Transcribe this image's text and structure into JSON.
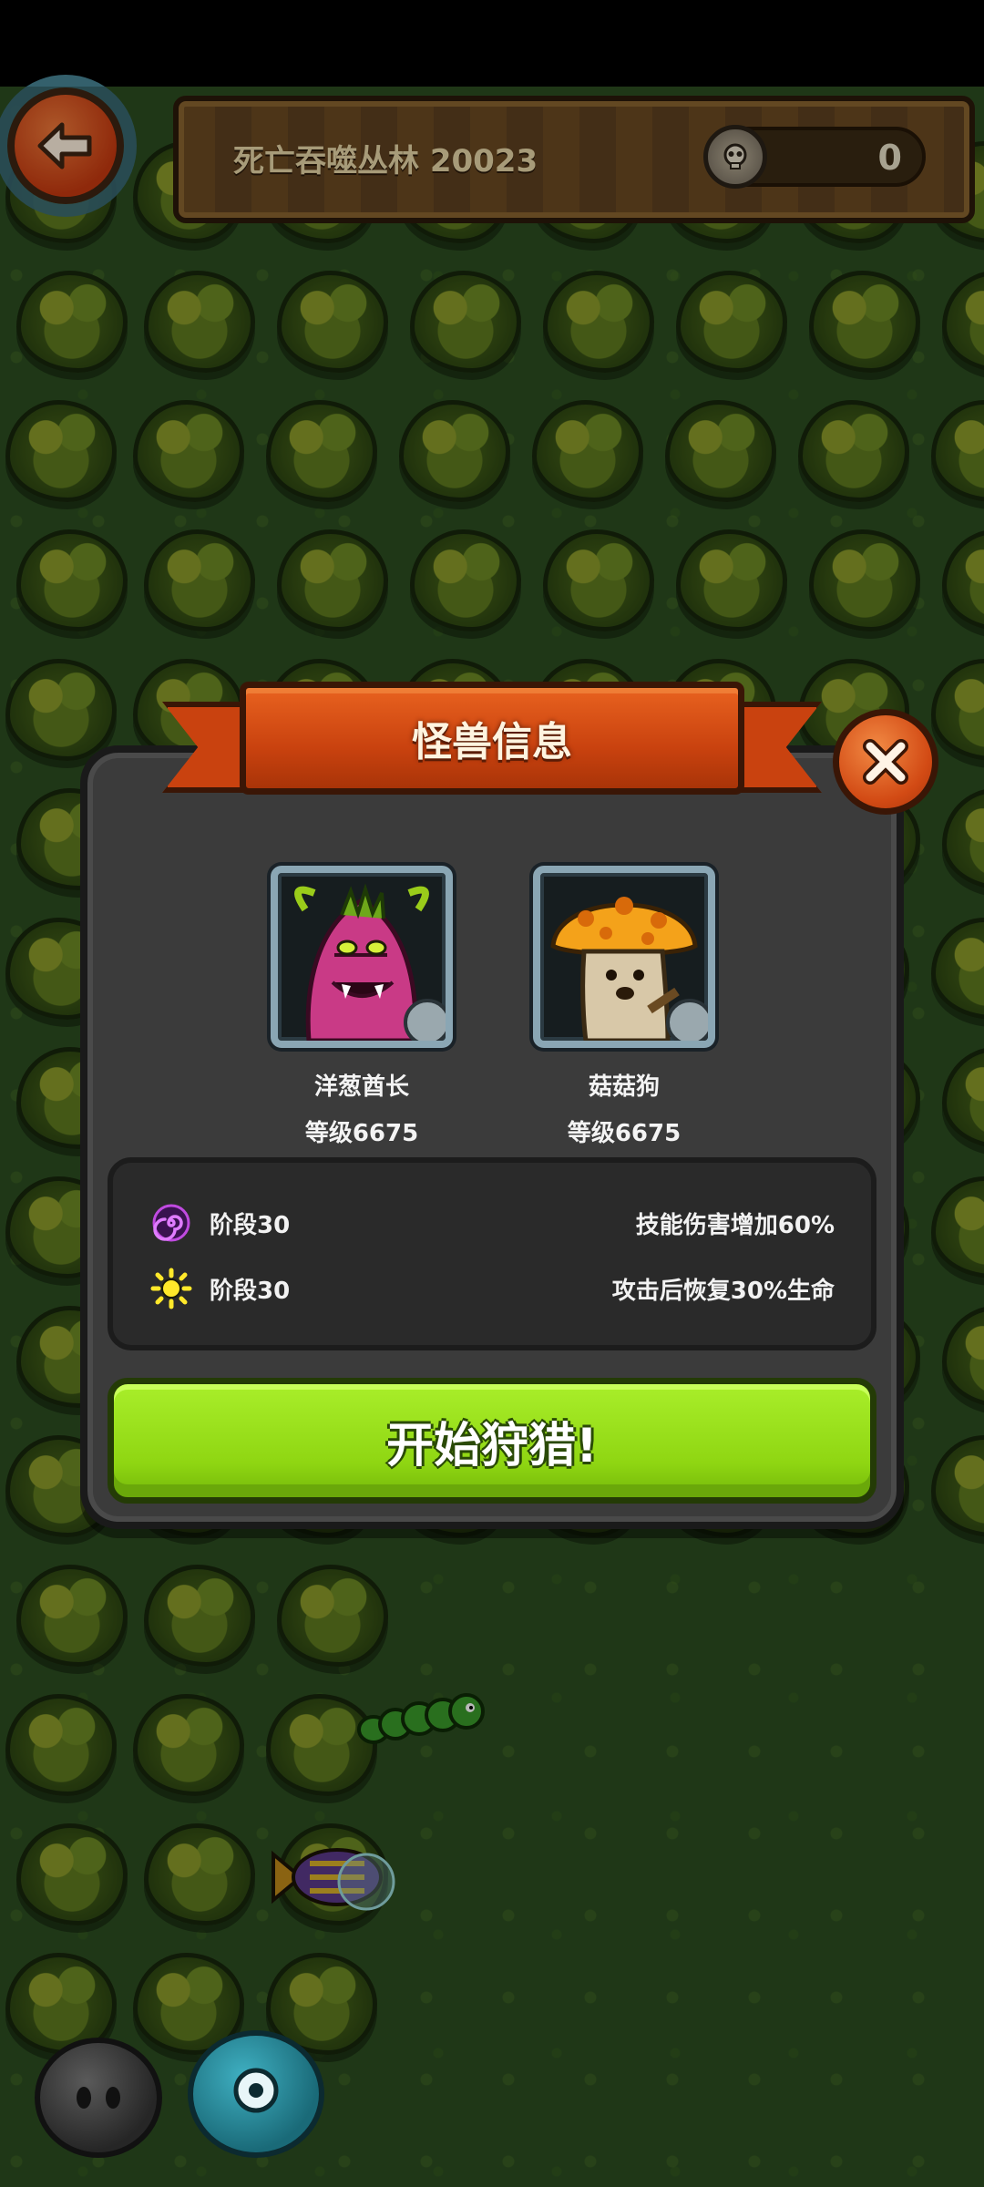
{
  "header": {
    "zone_title": "死亡吞噬丛林 20023",
    "currency_count": "0",
    "back_icon": "arrow-left-icon",
    "coin_icon": "skull-coin-icon"
  },
  "modal": {
    "title": "怪兽信息",
    "close_icon": "close-icon",
    "monsters": [
      {
        "name": "洋葱酋长",
        "level": "等级6675",
        "portrait": "onion-chief-portrait"
      },
      {
        "name": "菇菇狗",
        "level": "等级6675",
        "portrait": "mushroom-dog-portrait"
      }
    ],
    "stats": [
      {
        "icon": "purple-spiral-icon",
        "label": "阶段30",
        "effect": "技能伤害增加60%"
      },
      {
        "icon": "sun-icon",
        "label": "阶段30",
        "effect": "攻击后恢复30%生命"
      }
    ],
    "hunt_button": "开始狩猎!"
  },
  "colors": {
    "ribbon": "#c9420f",
    "hunt_button": "#8fd612",
    "modal_bg": "#3b3b3b"
  }
}
